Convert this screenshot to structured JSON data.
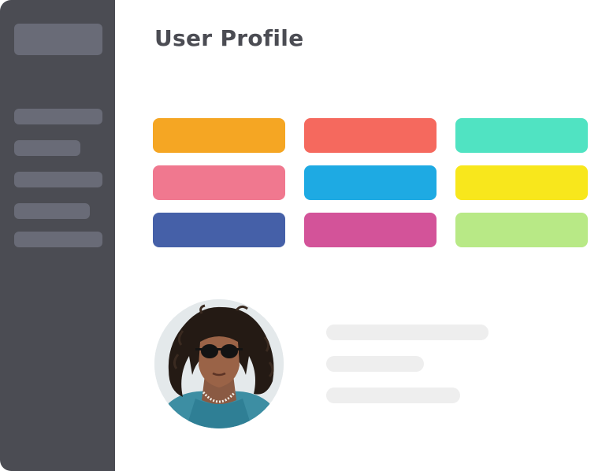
{
  "page": {
    "title": "User Profile"
  },
  "colors": {
    "sidebar_bg": "#4b4c53",
    "sidebar_placeholder": "#696b77",
    "title_text": "#4b4c53",
    "skeleton": "#eeeeee"
  },
  "sidebar": {
    "items": [
      {
        "name": "sidebar-item-1",
        "state": "placeholder"
      },
      {
        "name": "sidebar-item-2",
        "state": "placeholder"
      },
      {
        "name": "sidebar-item-3",
        "state": "placeholder"
      },
      {
        "name": "sidebar-item-4",
        "state": "placeholder"
      },
      {
        "name": "sidebar-item-5",
        "state": "placeholder"
      }
    ]
  },
  "color_tiles": [
    {
      "color": "#f5a623"
    },
    {
      "color": "#f5695e"
    },
    {
      "color": "#50e3c2"
    },
    {
      "color": "#f0788f"
    },
    {
      "color": "#1eaae3"
    },
    {
      "color": "#f8e71c"
    },
    {
      "color": "#4560a8"
    },
    {
      "color": "#d35399"
    },
    {
      "color": "#b8e986"
    }
  ],
  "profile": {
    "avatar": "user-avatar-photo",
    "detail_lines": [
      "placeholder",
      "placeholder",
      "placeholder"
    ]
  }
}
